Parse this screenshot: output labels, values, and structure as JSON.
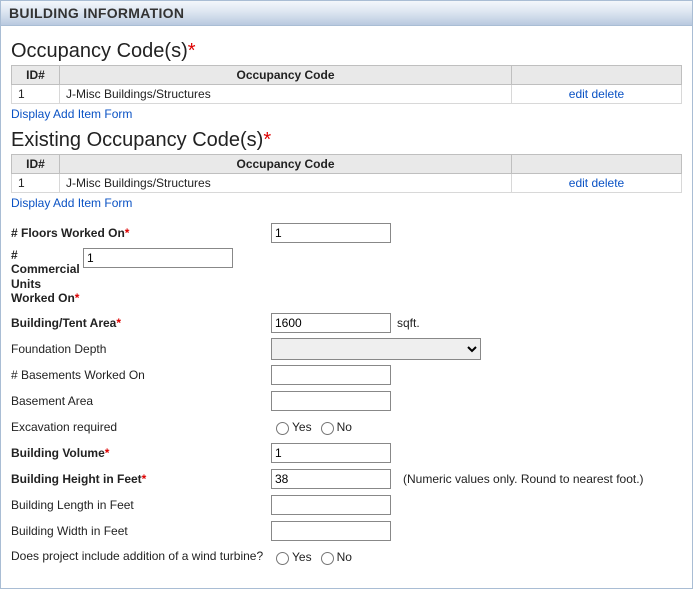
{
  "panel_title": "BUILDING INFORMATION",
  "required_mark": "*",
  "occupancy": {
    "title": "Occupancy Code(s)",
    "headers": {
      "id": "ID#",
      "code": "Occupancy Code"
    },
    "row": {
      "id": "1",
      "code": "J-Misc Buildings/Structures"
    },
    "actions": {
      "edit": "edit",
      "delete": "delete"
    },
    "add_form": "Display Add Item Form"
  },
  "existing_occupancy": {
    "title": "Existing Occupancy Code(s)",
    "headers": {
      "id": "ID#",
      "code": "Occupancy Code"
    },
    "row": {
      "id": "1",
      "code": "J-Misc Buildings/Structures"
    },
    "actions": {
      "edit": "edit",
      "delete": "delete"
    },
    "add_form": "Display Add Item Form"
  },
  "fields": {
    "floors": {
      "label": "# Floors Worked On",
      "value": "1"
    },
    "commercial_units": {
      "label": "# Commercial Units Worked On",
      "value": "1"
    },
    "area": {
      "label": "Building/Tent Area",
      "value": "1600",
      "unit": "sqft."
    },
    "foundation_depth": {
      "label": "Foundation Depth",
      "value": ""
    },
    "basements": {
      "label": "# Basements Worked On",
      "value": ""
    },
    "basement_area": {
      "label": "Basement Area",
      "value": ""
    },
    "excavation": {
      "label": "Excavation required",
      "yes": "Yes",
      "no": "No"
    },
    "volume": {
      "label": "Building Volume",
      "value": "1"
    },
    "height": {
      "label": "Building Height in Feet",
      "value": "38",
      "hint": "(Numeric values only. Round to nearest foot.)"
    },
    "length": {
      "label": "Building Length in Feet",
      "value": ""
    },
    "width": {
      "label": "Building Width in Feet",
      "value": ""
    },
    "turbine": {
      "label": "Does project include addition of a wind turbine?",
      "yes": "Yes",
      "no": "No"
    }
  }
}
